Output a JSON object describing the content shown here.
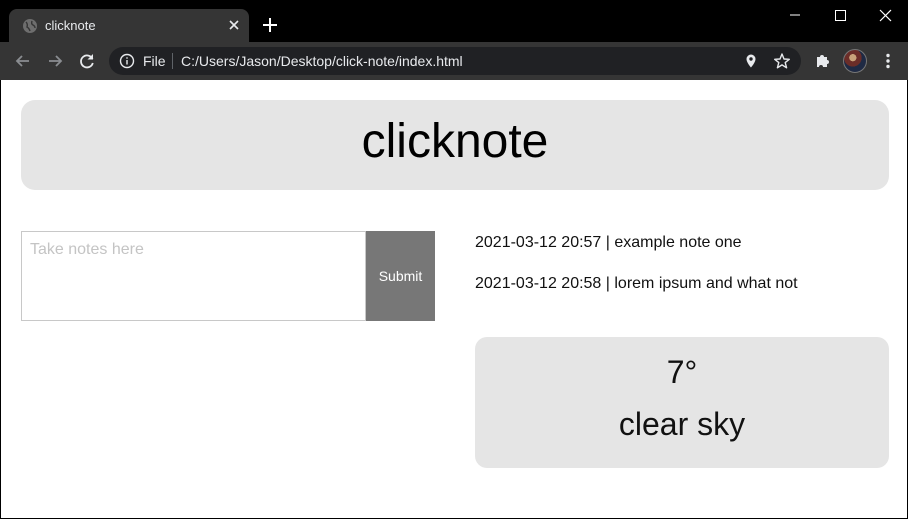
{
  "browser": {
    "tab": {
      "title": "clicknote"
    },
    "omnibox": {
      "scheme_label": "File",
      "url": "C:/Users/Jason/Desktop/click-note/index.html"
    }
  },
  "page": {
    "header": {
      "title": "clicknote"
    },
    "note_form": {
      "placeholder": "Take notes here",
      "value": "",
      "submit_label": "Submit"
    },
    "notes": [
      {
        "text": "2021-03-12 20:57 | example note one"
      },
      {
        "text": "2021-03-12 20:58 | lorem ipsum and what not"
      }
    ],
    "weather": {
      "temperature": "7°",
      "description": "clear sky"
    }
  },
  "colors": {
    "tab_strip": "#000000",
    "toolbar": "#353535",
    "omnibox": "#202124",
    "panel": "#e5e5e5",
    "submit_button": "#777777"
  }
}
